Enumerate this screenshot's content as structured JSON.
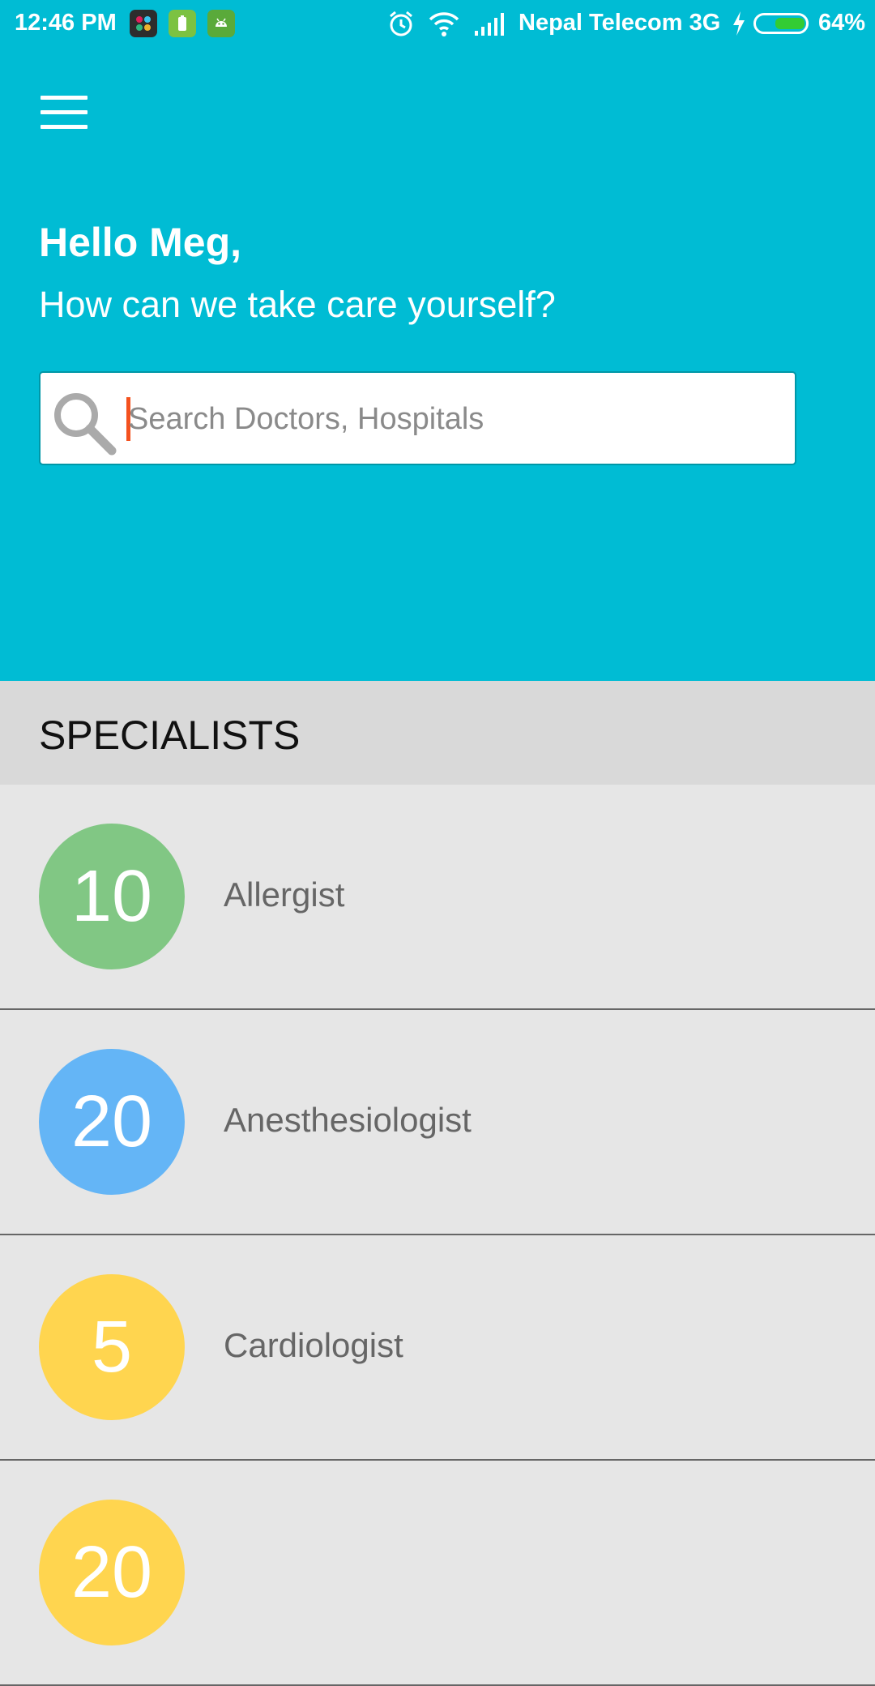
{
  "status_bar": {
    "time": "12:46 PM",
    "carrier": "Nepal Telecom 3G",
    "battery": "64%",
    "battery_level": 0.64,
    "icons": [
      "slack-icon",
      "battery-saver-icon",
      "android-icon",
      "alarm-icon",
      "wifi-icon",
      "signal-icon",
      "charging-icon"
    ]
  },
  "header": {
    "greeting": "Hello Meg,",
    "subtitle": "How can we take care yourself?",
    "search_placeholder": "Search Doctors, Hospitals",
    "search_value": ""
  },
  "specialists": {
    "title": "SPECIALISTS",
    "items": [
      {
        "count": "10",
        "label": "Allergist",
        "color": "#81c784"
      },
      {
        "count": "20",
        "label": "Anesthesiologist",
        "color": "#64b5f6"
      },
      {
        "count": "5",
        "label": "Cardiologist",
        "color": "#ffd54f"
      },
      {
        "count": "20",
        "label": "",
        "color": "#ffd54f"
      }
    ]
  },
  "colors": {
    "header_bg": "#00bcd4",
    "section_bg": "#d9d9d9",
    "list_bg": "#e6e6e6",
    "cursor": "#f4511e"
  }
}
